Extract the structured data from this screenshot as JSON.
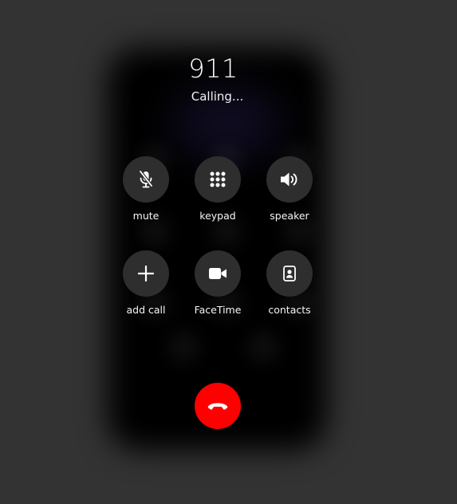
{
  "call": {
    "number": "911",
    "status": "Calling..."
  },
  "controls": [
    {
      "name": "mute",
      "label": "mute",
      "icon": "mic-off-icon"
    },
    {
      "name": "keypad",
      "label": "keypad",
      "icon": "keypad-icon"
    },
    {
      "name": "speaker",
      "label": "speaker",
      "icon": "speaker-icon"
    },
    {
      "name": "add-call",
      "label": "add call",
      "icon": "plus-icon"
    },
    {
      "name": "facetime",
      "label": "FaceTime",
      "icon": "video-camera-icon"
    },
    {
      "name": "contacts",
      "label": "contacts",
      "icon": "contact-card-icon"
    }
  ],
  "end_call": {
    "icon": "phone-hangup-icon",
    "color": "#ff0000"
  },
  "colors": {
    "background": "#333333",
    "phone": "#000000",
    "button": "#2e2e2e",
    "text": "#ffffff"
  }
}
